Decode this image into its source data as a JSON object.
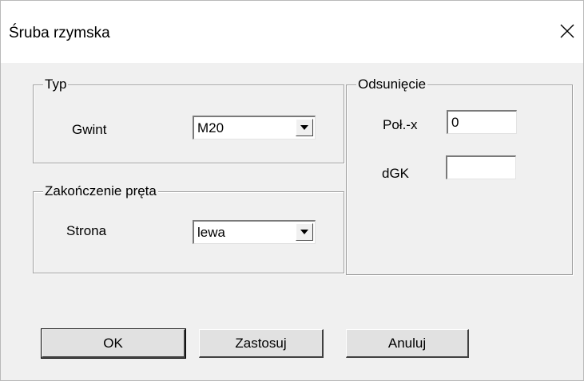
{
  "window": {
    "title": "Śruba rzymska",
    "close_glyph": "✕"
  },
  "groups": {
    "typ": {
      "label": "Typ",
      "gwint_label": "Gwint",
      "gwint_value": "M20"
    },
    "zakonczenie": {
      "label": "Zakończenie pręta",
      "strona_label": "Strona",
      "strona_value": "lewa"
    },
    "odsuniecie": {
      "label": "Odsunięcie",
      "polx_label": "Poł.-x",
      "polx_value": "0",
      "dgk_label": "dGK",
      "dgk_value": ""
    }
  },
  "buttons": {
    "ok": "OK",
    "apply": "Zastosuj",
    "cancel": "Anuluj"
  },
  "icons": {
    "close": "close-icon",
    "dropdown": "chevron-down-icon"
  }
}
